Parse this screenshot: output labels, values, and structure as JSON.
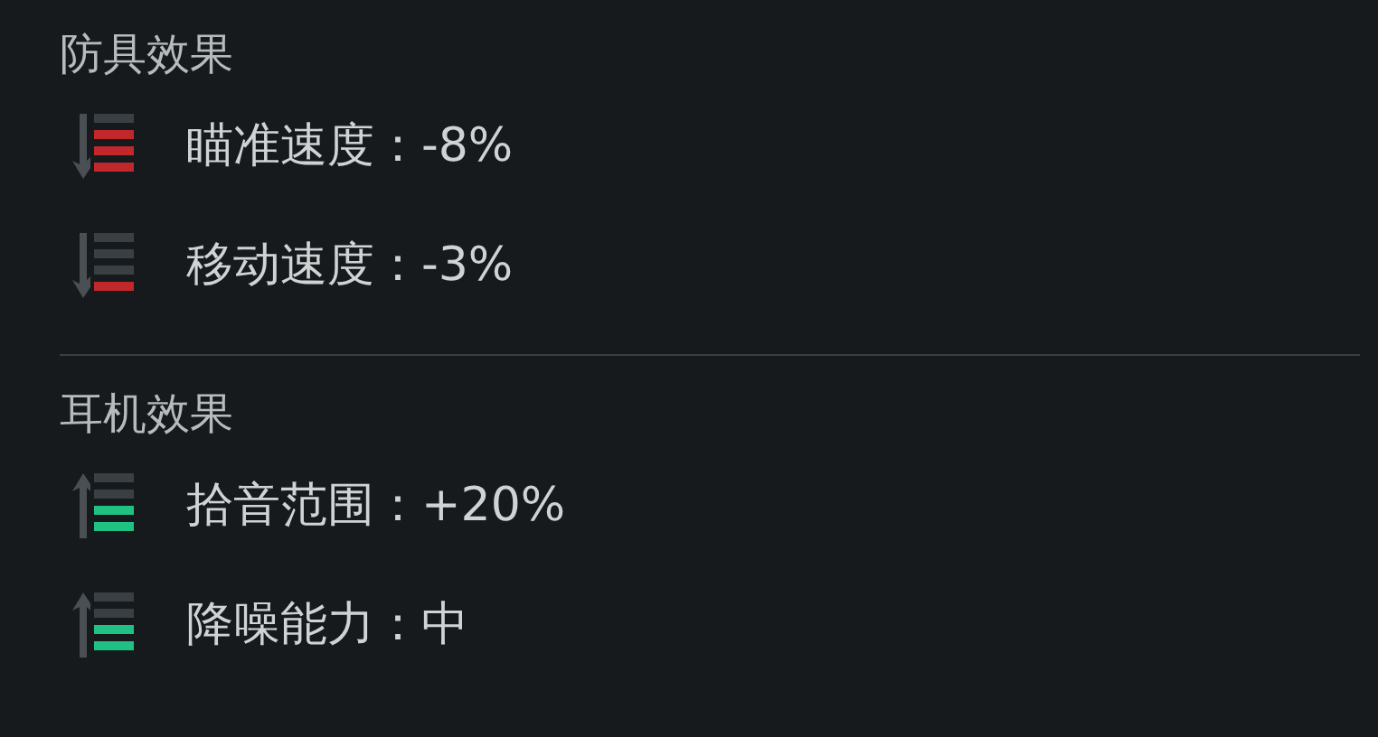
{
  "sections": [
    {
      "title": "防具效果",
      "effects": [
        {
          "kind": "down",
          "color": "#c0282c",
          "bars": [
            {
              "on": false
            },
            {
              "on": true
            },
            {
              "on": true
            },
            {
              "on": true
            }
          ],
          "label": "瞄准速度：-8%"
        },
        {
          "kind": "down",
          "color": "#c0282c",
          "bars": [
            {
              "on": false
            },
            {
              "on": false
            },
            {
              "on": false
            },
            {
              "on": true
            }
          ],
          "label": "移动速度：-3%"
        }
      ]
    },
    {
      "title": "耳机效果",
      "effects": [
        {
          "kind": "up",
          "color": "#1fc283",
          "bars": [
            {
              "on": false
            },
            {
              "on": false
            },
            {
              "on": true
            },
            {
              "on": true
            }
          ],
          "label": "拾音范围：+20%"
        },
        {
          "kind": "up",
          "color": "#1fc283",
          "bars": [
            {
              "on": false
            },
            {
              "on": false
            },
            {
              "on": true
            },
            {
              "on": true
            }
          ],
          "label": "降噪能力：中"
        }
      ]
    }
  ]
}
